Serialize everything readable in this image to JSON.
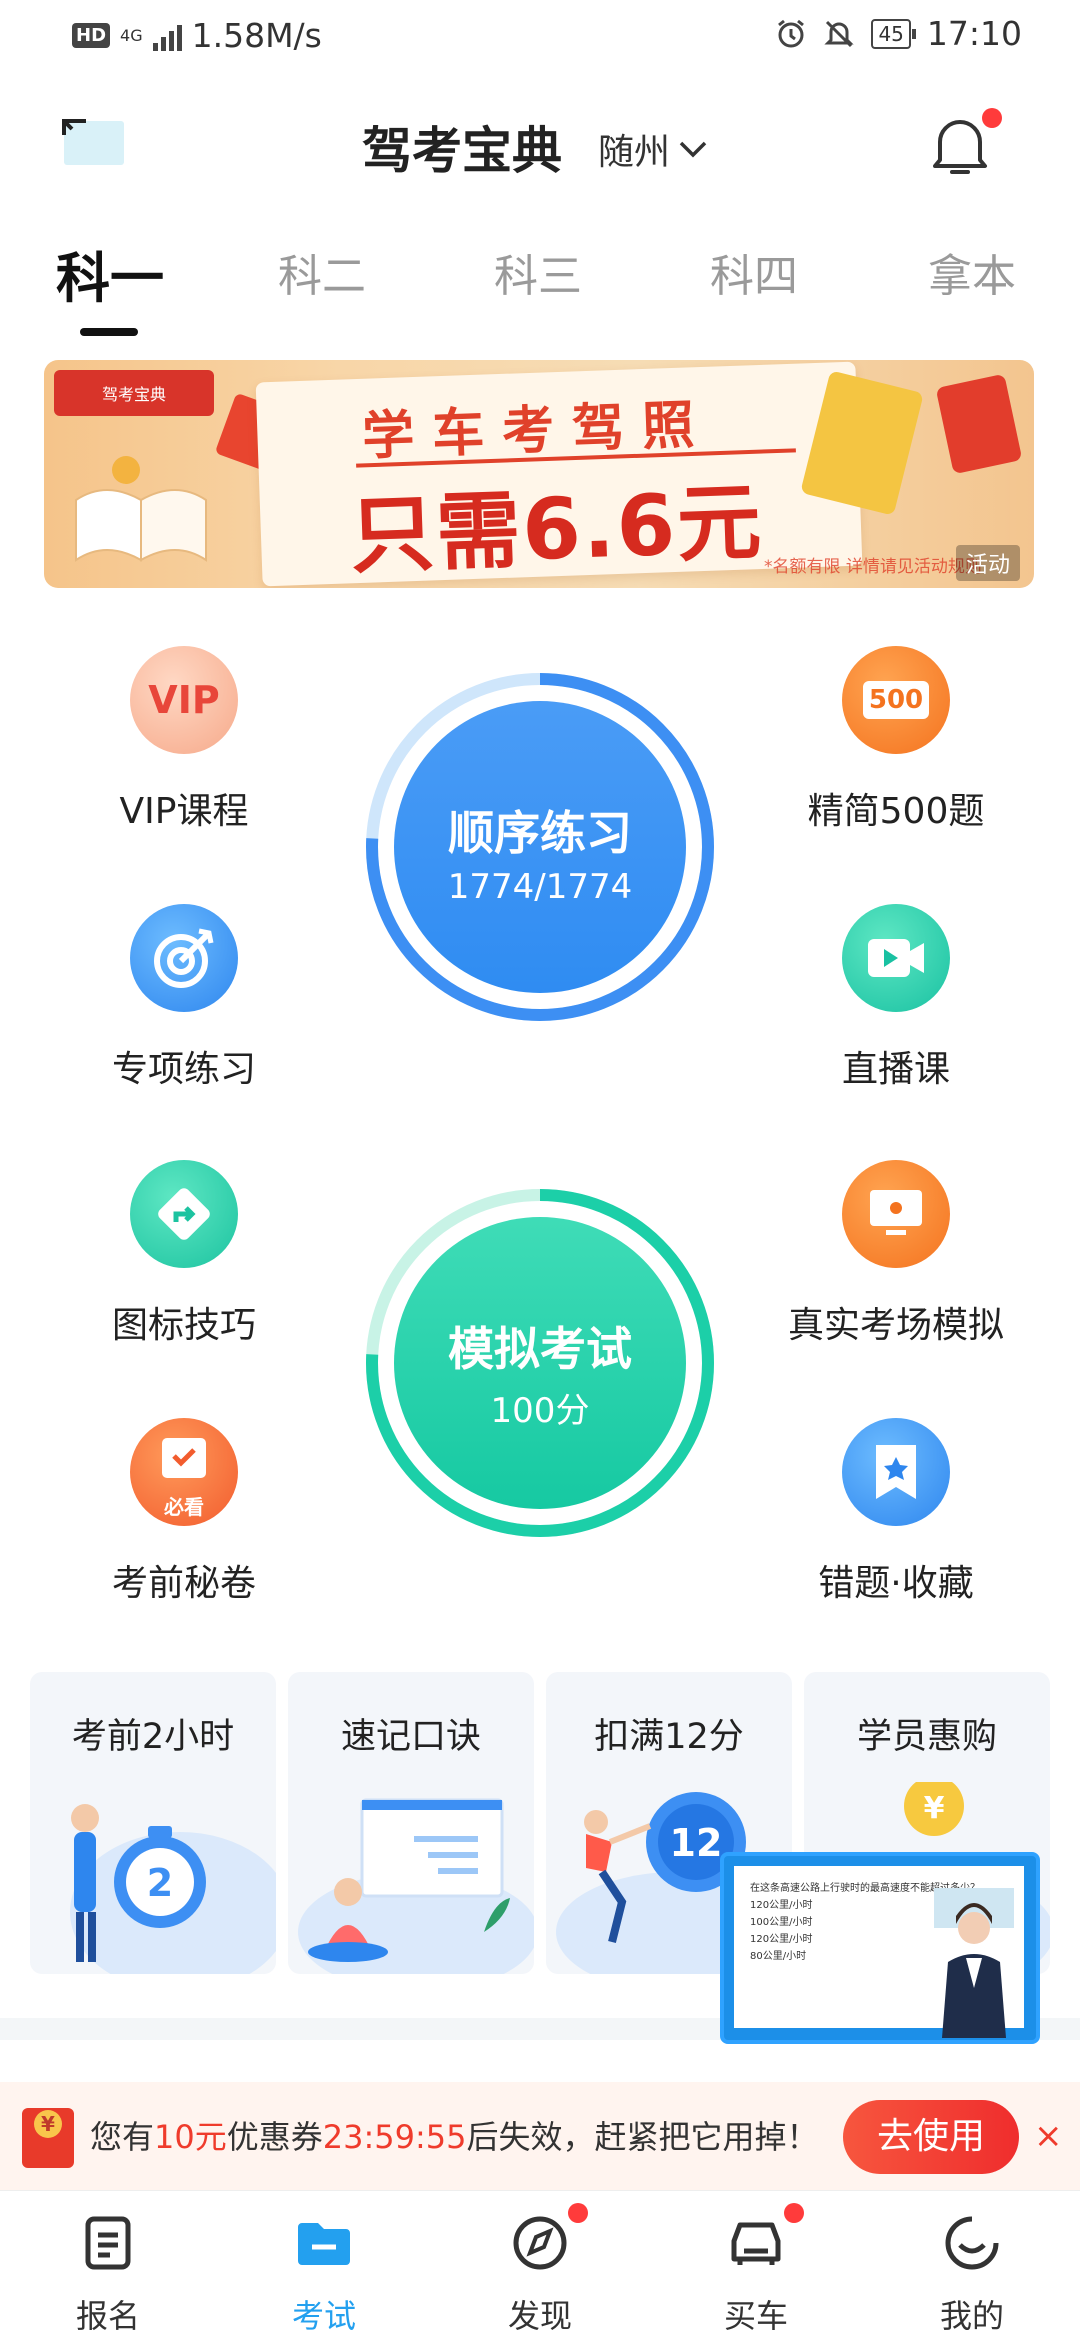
{
  "status_bar": {
    "hd": "HD",
    "network": "4G",
    "speed": "1.58M/s",
    "battery": "45",
    "time": "17:10"
  },
  "header": {
    "title": "驾考宝典",
    "city": "随州"
  },
  "tabs": [
    {
      "label": "科一",
      "active": true
    },
    {
      "label": "科二",
      "active": false
    },
    {
      "label": "科三",
      "active": false
    },
    {
      "label": "科四",
      "active": false
    },
    {
      "label": "拿本",
      "active": false
    }
  ],
  "banner": {
    "line1": "学车考驾照",
    "line2": "只需6.6元",
    "tag": "活动",
    "note": "*名额有限 详情请见活动规则",
    "brand": "驾考宝典"
  },
  "features": {
    "vip": {
      "label": "VIP课程",
      "icon_text": "VIP"
    },
    "simple500": {
      "label": "精简500题",
      "icon_text": "500"
    },
    "special": {
      "label": "专项练习"
    },
    "live": {
      "label": "直播课"
    },
    "signs": {
      "label": "图标技巧"
    },
    "real_exam": {
      "label": "真实考场模拟"
    },
    "secret": {
      "label": "考前秘卷",
      "icon_text": "必看"
    },
    "mistakes": {
      "label": "错题·收藏"
    }
  },
  "sequential": {
    "title": "顺序练习",
    "progress_text": "1774/1774",
    "progress": 1.0
  },
  "mock": {
    "title": "模拟考试",
    "score_text": "100分",
    "progress": 1.0
  },
  "cards": [
    {
      "title": "考前2小时",
      "badge": "2"
    },
    {
      "title": "速记口诀"
    },
    {
      "title": "扣满12分",
      "badge": "12"
    },
    {
      "title": "学员惠购",
      "badge": "¥"
    }
  ],
  "video": {
    "question": "在这条高速公路上行驶时的最高速度不能超过多少？",
    "options": [
      "120公里/小时",
      "100公里/小时",
      "120公里/小时",
      "80公里/小时"
    ]
  },
  "coupon": {
    "prefix": "您有",
    "amount": "10元",
    "middle": "优惠券",
    "countdown": "23:59:55",
    "suffix": "后失效，赶紧把它用掉！",
    "button": "去使用",
    "close": "×"
  },
  "bottom_nav": [
    {
      "label": "报名",
      "icon": "form-icon",
      "active": false,
      "dot": false
    },
    {
      "label": "考试",
      "icon": "folder-icon",
      "active": true,
      "dot": false
    },
    {
      "label": "发现",
      "icon": "compass-icon",
      "active": false,
      "dot": true
    },
    {
      "label": "买车",
      "icon": "car-icon",
      "active": false,
      "dot": true
    },
    {
      "label": "我的",
      "icon": "smile-icon",
      "active": false,
      "dot": false
    }
  ],
  "colors": {
    "accent_blue": "#23a0ef",
    "accent_red": "#ef3b2c",
    "mock_green": "#1ccfa8",
    "sequential_blue": "#3c8df5"
  }
}
